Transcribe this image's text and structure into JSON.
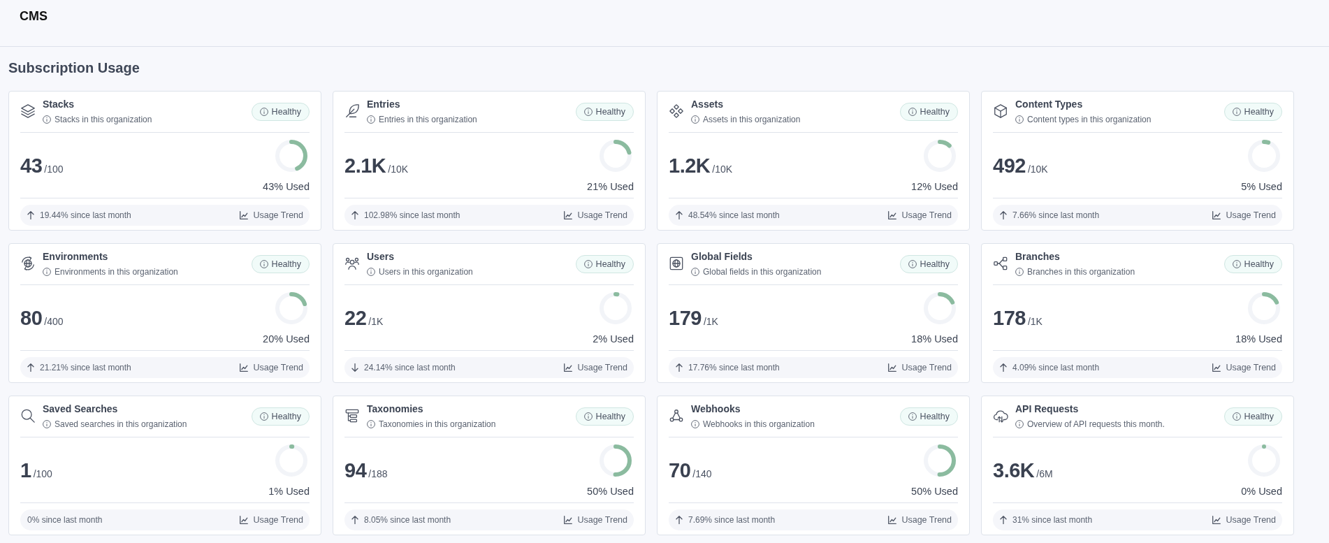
{
  "header": {
    "title": "CMS"
  },
  "section": {
    "title": "Subscription Usage"
  },
  "cards": [
    {
      "title": "Stacks",
      "description": "Stacks in this organization",
      "status": "Healthy",
      "value": "43",
      "limit": "/100",
      "level": 0.43,
      "used": "43% Used",
      "trend": {
        "kind": "up",
        "text": "19.44% since last month"
      },
      "link": "Usage Trend"
    },
    {
      "title": "Entries",
      "description": "Entries in this organization",
      "status": "Healthy",
      "value": "2.1K",
      "limit": "/10K",
      "level": 0.21,
      "used": "21% Used",
      "trend": {
        "kind": "up",
        "text": "102.98% since last month"
      },
      "link": "Usage Trend"
    },
    {
      "title": "Assets",
      "description": "Assets in this organization",
      "status": "Healthy",
      "value": "1.2K",
      "limit": "/10K",
      "level": 0.12,
      "used": "12% Used",
      "trend": {
        "kind": "up",
        "text": "48.54% since last month"
      },
      "link": "Usage Trend"
    },
    {
      "title": "Content Types",
      "description": "Content types in this organization",
      "status": "Healthy",
      "value": "492",
      "limit": "/10K",
      "level": 0.05,
      "used": "5% Used",
      "trend": {
        "kind": "up",
        "text": "7.66% since last month"
      },
      "link": "Usage Trend"
    },
    {
      "title": "Environments",
      "description": "Environments in this organization",
      "status": "Healthy",
      "value": "80",
      "limit": "/400",
      "level": 0.2,
      "used": "20% Used",
      "trend": {
        "kind": "up",
        "text": "21.21% since last month"
      },
      "link": "Usage Trend"
    },
    {
      "title": "Users",
      "description": "Users in this organization",
      "status": "Healthy",
      "value": "22",
      "limit": "/1K",
      "level": 0.02,
      "used": "2% Used",
      "trend": {
        "kind": "down",
        "text": "24.14% since last month"
      },
      "link": "Usage Trend"
    },
    {
      "title": "Global Fields",
      "description": "Global fields in this organization",
      "status": "Healthy",
      "value": "179",
      "limit": "/1K",
      "level": 0.18,
      "used": "18% Used",
      "trend": {
        "kind": "up",
        "text": "17.76% since last month"
      },
      "link": "Usage Trend"
    },
    {
      "title": "Branches",
      "description": "Branches in this organization",
      "status": "Healthy",
      "value": "178",
      "limit": "/1K",
      "level": 0.18,
      "used": "18% Used",
      "trend": {
        "kind": "up",
        "text": "4.09% since last month"
      },
      "link": "Usage Trend"
    },
    {
      "title": "Saved Searches",
      "description": "Saved searches in this organization",
      "status": "Healthy",
      "value": "1",
      "limit": "/100",
      "level": 0.01,
      "used": "1% Used",
      "trend": {
        "kind": "none",
        "text": "0% since last month"
      },
      "link": "Usage Trend"
    },
    {
      "title": "Taxonomies",
      "description": "Taxonomies in this organization",
      "status": "Healthy",
      "value": "94",
      "limit": "/188",
      "level": 0.5,
      "used": "50% Used",
      "trend": {
        "kind": "up",
        "text": "8.05% since last month"
      },
      "link": "Usage Trend"
    },
    {
      "title": "Webhooks",
      "description": "Webhooks in this organization",
      "status": "Healthy",
      "value": "70",
      "limit": "/140",
      "level": 0.5,
      "used": "50% Used",
      "trend": {
        "kind": "up",
        "text": "7.69% since last month"
      },
      "link": "Usage Trend"
    },
    {
      "title": "API Requests",
      "description": "Overview of API requests this month.",
      "status": "Healthy",
      "value": "3.6K",
      "limit": "/6M",
      "level": 0,
      "used": "0% Used",
      "trend": {
        "kind": "up",
        "text": "31% since last month"
      },
      "link": "Usage Trend"
    }
  ]
}
